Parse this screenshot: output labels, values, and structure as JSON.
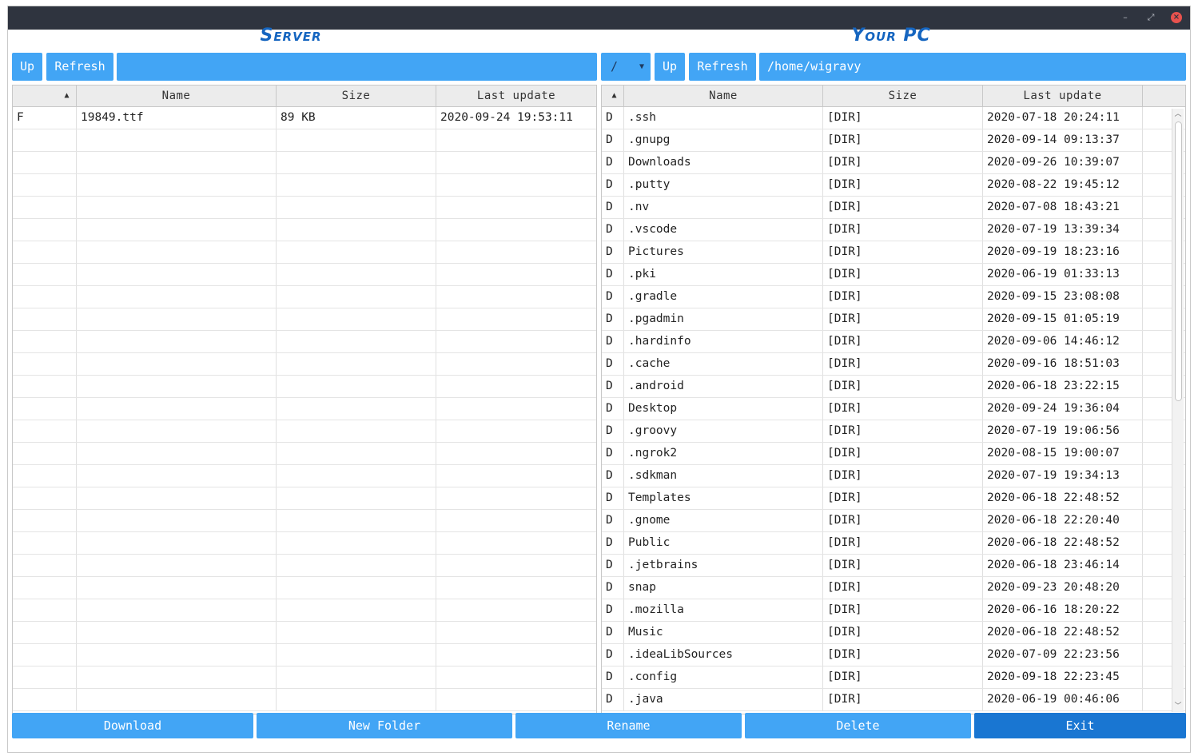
{
  "window": {
    "controls": {
      "minimize": "–",
      "maximize": "⤢",
      "close": "×"
    }
  },
  "server": {
    "title": "Server",
    "up_label": "Up",
    "refresh_label": "Refresh",
    "path": "",
    "columns": [
      "",
      "Name",
      "Size",
      "Last update"
    ],
    "rows": [
      {
        "type": "F",
        "name": "19849.ttf",
        "size": "89 KB",
        "updated": "2020-09-24 19:53:11"
      }
    ]
  },
  "pc": {
    "title": "Your PC",
    "drive": "/",
    "up_label": "Up",
    "refresh_label": "Refresh",
    "path": "/home/wigravy",
    "columns": [
      "",
      "Name",
      "Size",
      "Last update"
    ],
    "rows": [
      {
        "type": "D",
        "name": ".ssh",
        "size": "[DIR]",
        "updated": "2020-07-18 20:24:11"
      },
      {
        "type": "D",
        "name": ".gnupg",
        "size": "[DIR]",
        "updated": "2020-09-14 09:13:37"
      },
      {
        "type": "D",
        "name": "Downloads",
        "size": "[DIR]",
        "updated": "2020-09-26 10:39:07"
      },
      {
        "type": "D",
        "name": ".putty",
        "size": "[DIR]",
        "updated": "2020-08-22 19:45:12"
      },
      {
        "type": "D",
        "name": ".nv",
        "size": "[DIR]",
        "updated": "2020-07-08 18:43:21"
      },
      {
        "type": "D",
        "name": ".vscode",
        "size": "[DIR]",
        "updated": "2020-07-19 13:39:34"
      },
      {
        "type": "D",
        "name": "Pictures",
        "size": "[DIR]",
        "updated": "2020-09-19 18:23:16"
      },
      {
        "type": "D",
        "name": ".pki",
        "size": "[DIR]",
        "updated": "2020-06-19 01:33:13"
      },
      {
        "type": "D",
        "name": ".gradle",
        "size": "[DIR]",
        "updated": "2020-09-15 23:08:08"
      },
      {
        "type": "D",
        "name": ".pgadmin",
        "size": "[DIR]",
        "updated": "2020-09-15 01:05:19"
      },
      {
        "type": "D",
        "name": ".hardinfo",
        "size": "[DIR]",
        "updated": "2020-09-06 14:46:12"
      },
      {
        "type": "D",
        "name": ".cache",
        "size": "[DIR]",
        "updated": "2020-09-16 18:51:03"
      },
      {
        "type": "D",
        "name": ".android",
        "size": "[DIR]",
        "updated": "2020-06-18 23:22:15"
      },
      {
        "type": "D",
        "name": "Desktop",
        "size": "[DIR]",
        "updated": "2020-09-24 19:36:04"
      },
      {
        "type": "D",
        "name": ".groovy",
        "size": "[DIR]",
        "updated": "2020-07-19 19:06:56"
      },
      {
        "type": "D",
        "name": ".ngrok2",
        "size": "[DIR]",
        "updated": "2020-08-15 19:00:07"
      },
      {
        "type": "D",
        "name": ".sdkman",
        "size": "[DIR]",
        "updated": "2020-07-19 19:34:13"
      },
      {
        "type": "D",
        "name": "Templates",
        "size": "[DIR]",
        "updated": "2020-06-18 22:48:52"
      },
      {
        "type": "D",
        "name": ".gnome",
        "size": "[DIR]",
        "updated": "2020-06-18 22:20:40"
      },
      {
        "type": "D",
        "name": "Public",
        "size": "[DIR]",
        "updated": "2020-06-18 22:48:52"
      },
      {
        "type": "D",
        "name": ".jetbrains",
        "size": "[DIR]",
        "updated": "2020-06-18 23:46:14"
      },
      {
        "type": "D",
        "name": "snap",
        "size": "[DIR]",
        "updated": "2020-09-23 20:48:20"
      },
      {
        "type": "D",
        "name": ".mozilla",
        "size": "[DIR]",
        "updated": "2020-06-16 18:20:22"
      },
      {
        "type": "D",
        "name": "Music",
        "size": "[DIR]",
        "updated": "2020-06-18 22:48:52"
      },
      {
        "type": "D",
        "name": ".ideaLibSources",
        "size": "[DIR]",
        "updated": "2020-07-09 22:23:56"
      },
      {
        "type": "D",
        "name": ".config",
        "size": "[DIR]",
        "updated": "2020-09-18 22:23:45"
      },
      {
        "type": "D",
        "name": ".java",
        "size": "[DIR]",
        "updated": "2020-06-19 00:46:06"
      }
    ]
  },
  "actions": {
    "download": "Download",
    "new_folder": "New Folder",
    "rename": "Rename",
    "delete": "Delete",
    "exit": "Exit"
  },
  "colors": {
    "accent": "#42a5f5",
    "accent_dark": "#1565c0",
    "titlebar": "#2f343f",
    "close": "#e8524e"
  }
}
